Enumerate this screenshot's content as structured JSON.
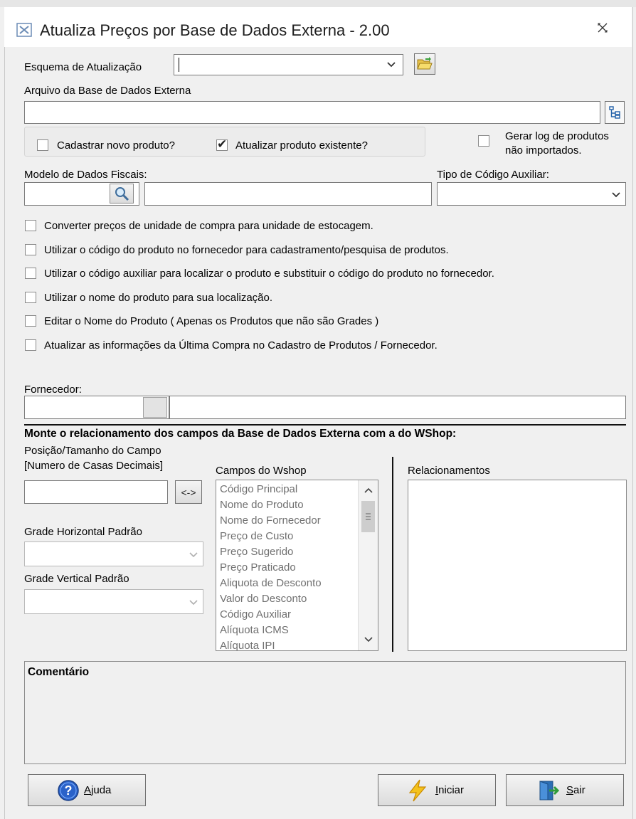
{
  "window": {
    "title": "Atualiza Preços por Base de Dados Externa - 2.00",
    "close_icon": "close-icon"
  },
  "esquema": {
    "label": "Esquema de Atualização",
    "value": "",
    "open_icon": "folder-open-icon"
  },
  "arquivo": {
    "label": "Arquivo da Base de Dados Externa",
    "value": "",
    "browse_icon": "tree-browse-icon"
  },
  "options_group": {
    "cadastrar_label": "Cadastrar novo produto?",
    "cadastrar_checked": false,
    "atualizar_label": "Atualizar produto existente?",
    "atualizar_checked": true
  },
  "gerar_log": {
    "label_line1": "Gerar log de produtos",
    "label_line2": "não importados.",
    "checked": false
  },
  "modelo": {
    "label": "Modelo de Dados Fiscais:",
    "code": "",
    "name": "",
    "search_icon": "magnifier-icon"
  },
  "tipo_codigo": {
    "label": "Tipo de Código Auxiliar:",
    "value": ""
  },
  "checks": [
    {
      "label": "Converter preços de unidade de compra para unidade de estocagem.",
      "checked": false
    },
    {
      "label": "Utilizar o código do produto no fornecedor para cadastramento/pesquisa de produtos.",
      "checked": false
    },
    {
      "label": "Utilizar o código auxiliar para localizar o produto e substituir o código do produto no fornecedor.",
      "checked": false
    },
    {
      "label": "Utilizar o nome do produto para sua localização.",
      "checked": false
    },
    {
      "label": "Editar o Nome do Produto  ( Apenas os Produtos que não são Grades )",
      "checked": false
    },
    {
      "label": "Atualizar as informações da Última Compra no Cadastro de Produtos / Fornecedor.",
      "checked": false
    }
  ],
  "fornecedor": {
    "label": "Fornecedor:",
    "code": "",
    "name": ""
  },
  "mapping": {
    "heading": "Monte o relacionamento dos campos da Base de Dados Externa com a do WShop:",
    "pos_label_line1": "Posição/Tamanho do Campo",
    "pos_label_line2": "[Numero de Casas Decimais]",
    "pos_value": "",
    "link_button": "<->",
    "grade_h_label": "Grade Horizontal Padrão",
    "grade_v_label": "Grade Vertical Padrão",
    "campos_label": "Campos do Wshop",
    "campos": [
      "Código Principal",
      "Nome do Produto",
      "Nome do Fornecedor",
      "Preço de Custo",
      "Preço Sugerido",
      "Preço Praticado",
      "Aliquota de Desconto",
      "Valor do Desconto",
      "Código Auxiliar",
      "Alíquota ICMS",
      "Alíquota IPI"
    ],
    "relacionamentos_label": "Relacionamentos"
  },
  "comentario": {
    "title": "Comentário",
    "text": ""
  },
  "buttons": {
    "ajuda_prefix": "A",
    "ajuda_rest": "juda",
    "iniciar_prefix": "I",
    "iniciar_rest": "niciar",
    "sair_prefix": "S",
    "sair_rest": "air"
  },
  "colors": {
    "help_blue": "#2a62c9",
    "bolt_yellow": "#f4c21c",
    "window_bg": "#f0f0f0"
  }
}
